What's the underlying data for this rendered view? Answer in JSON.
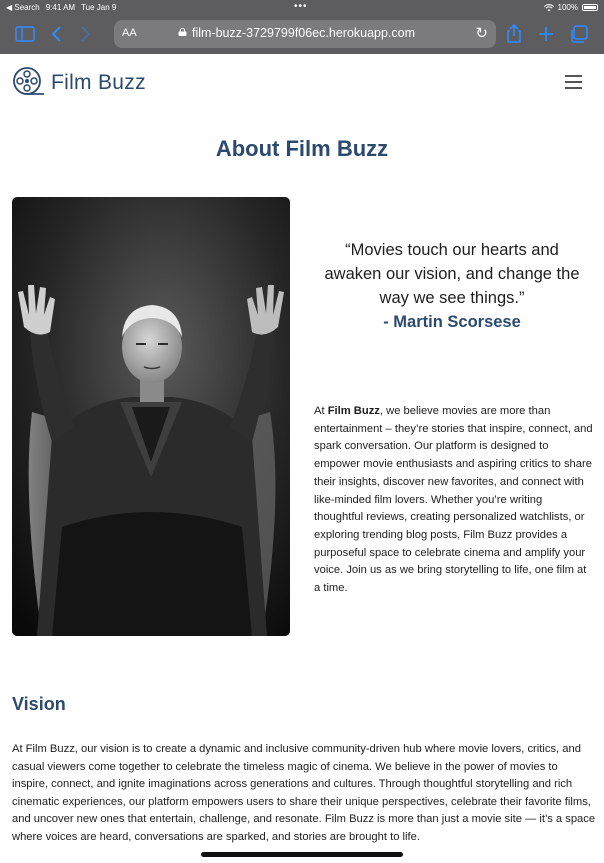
{
  "status_bar": {
    "carrier": "◀ Search",
    "time": "9:41 AM",
    "date": "Tue Jan 9",
    "battery": "100%"
  },
  "browser": {
    "text_size_label": "AA",
    "url": "film-buzz-3729799f06ec.herokuapp.com",
    "accent_color": "#2f8bff"
  },
  "header": {
    "brand": "Film Buzz"
  },
  "page": {
    "title": "About Film Buzz"
  },
  "quote": {
    "text": "“Movies touch our hearts and awaken our vision, and change the way we see things.”",
    "author": "- Martin Scorsese"
  },
  "about": {
    "brand_bold": "Film Buzz",
    "intro": "At ",
    "body": ", we believe movies are more than entertainment – they’re stories that inspire, connect, and spark conversation. Our platform is designed to empower movie enthusiasts and aspiring critics to share their insights, discover new favorites, and connect with like-minded film lovers. Whether you’re writing thoughtful reviews, creating personalized watchlists, or exploring trending blog posts, Film Buzz provides a purposeful space to celebrate cinema and amplify your voice. Join us as we bring storytelling to life, one film at a time."
  },
  "vision": {
    "heading": "Vision",
    "text": "At Film Buzz, our vision is to create a dynamic and inclusive community-driven hub where movie lovers, critics, and casual viewers come together to celebrate the timeless magic of cinema. We believe in the power of movies to inspire, connect, and ignite imaginations across generations and cultures. Through thoughtful storytelling and rich cinematic experiences, our platform empowers users to share their unique perspectives, celebrate their favorite films, and uncover new ones that entertain, challenge, and resonate. Film Buzz is more than just a movie site — it’s a space where voices are heard, conversations are sparked, and stories are brought to life."
  },
  "colors": {
    "brand": "#2c4a6e",
    "browser_chrome": "#5d5d5f"
  },
  "icons": [
    "sidebar-icon",
    "back-icon",
    "forward-icon",
    "lock-icon",
    "reload-icon",
    "share-icon",
    "new-tab-icon",
    "tabs-icon",
    "film-reel-icon",
    "hamburger-icon"
  ]
}
